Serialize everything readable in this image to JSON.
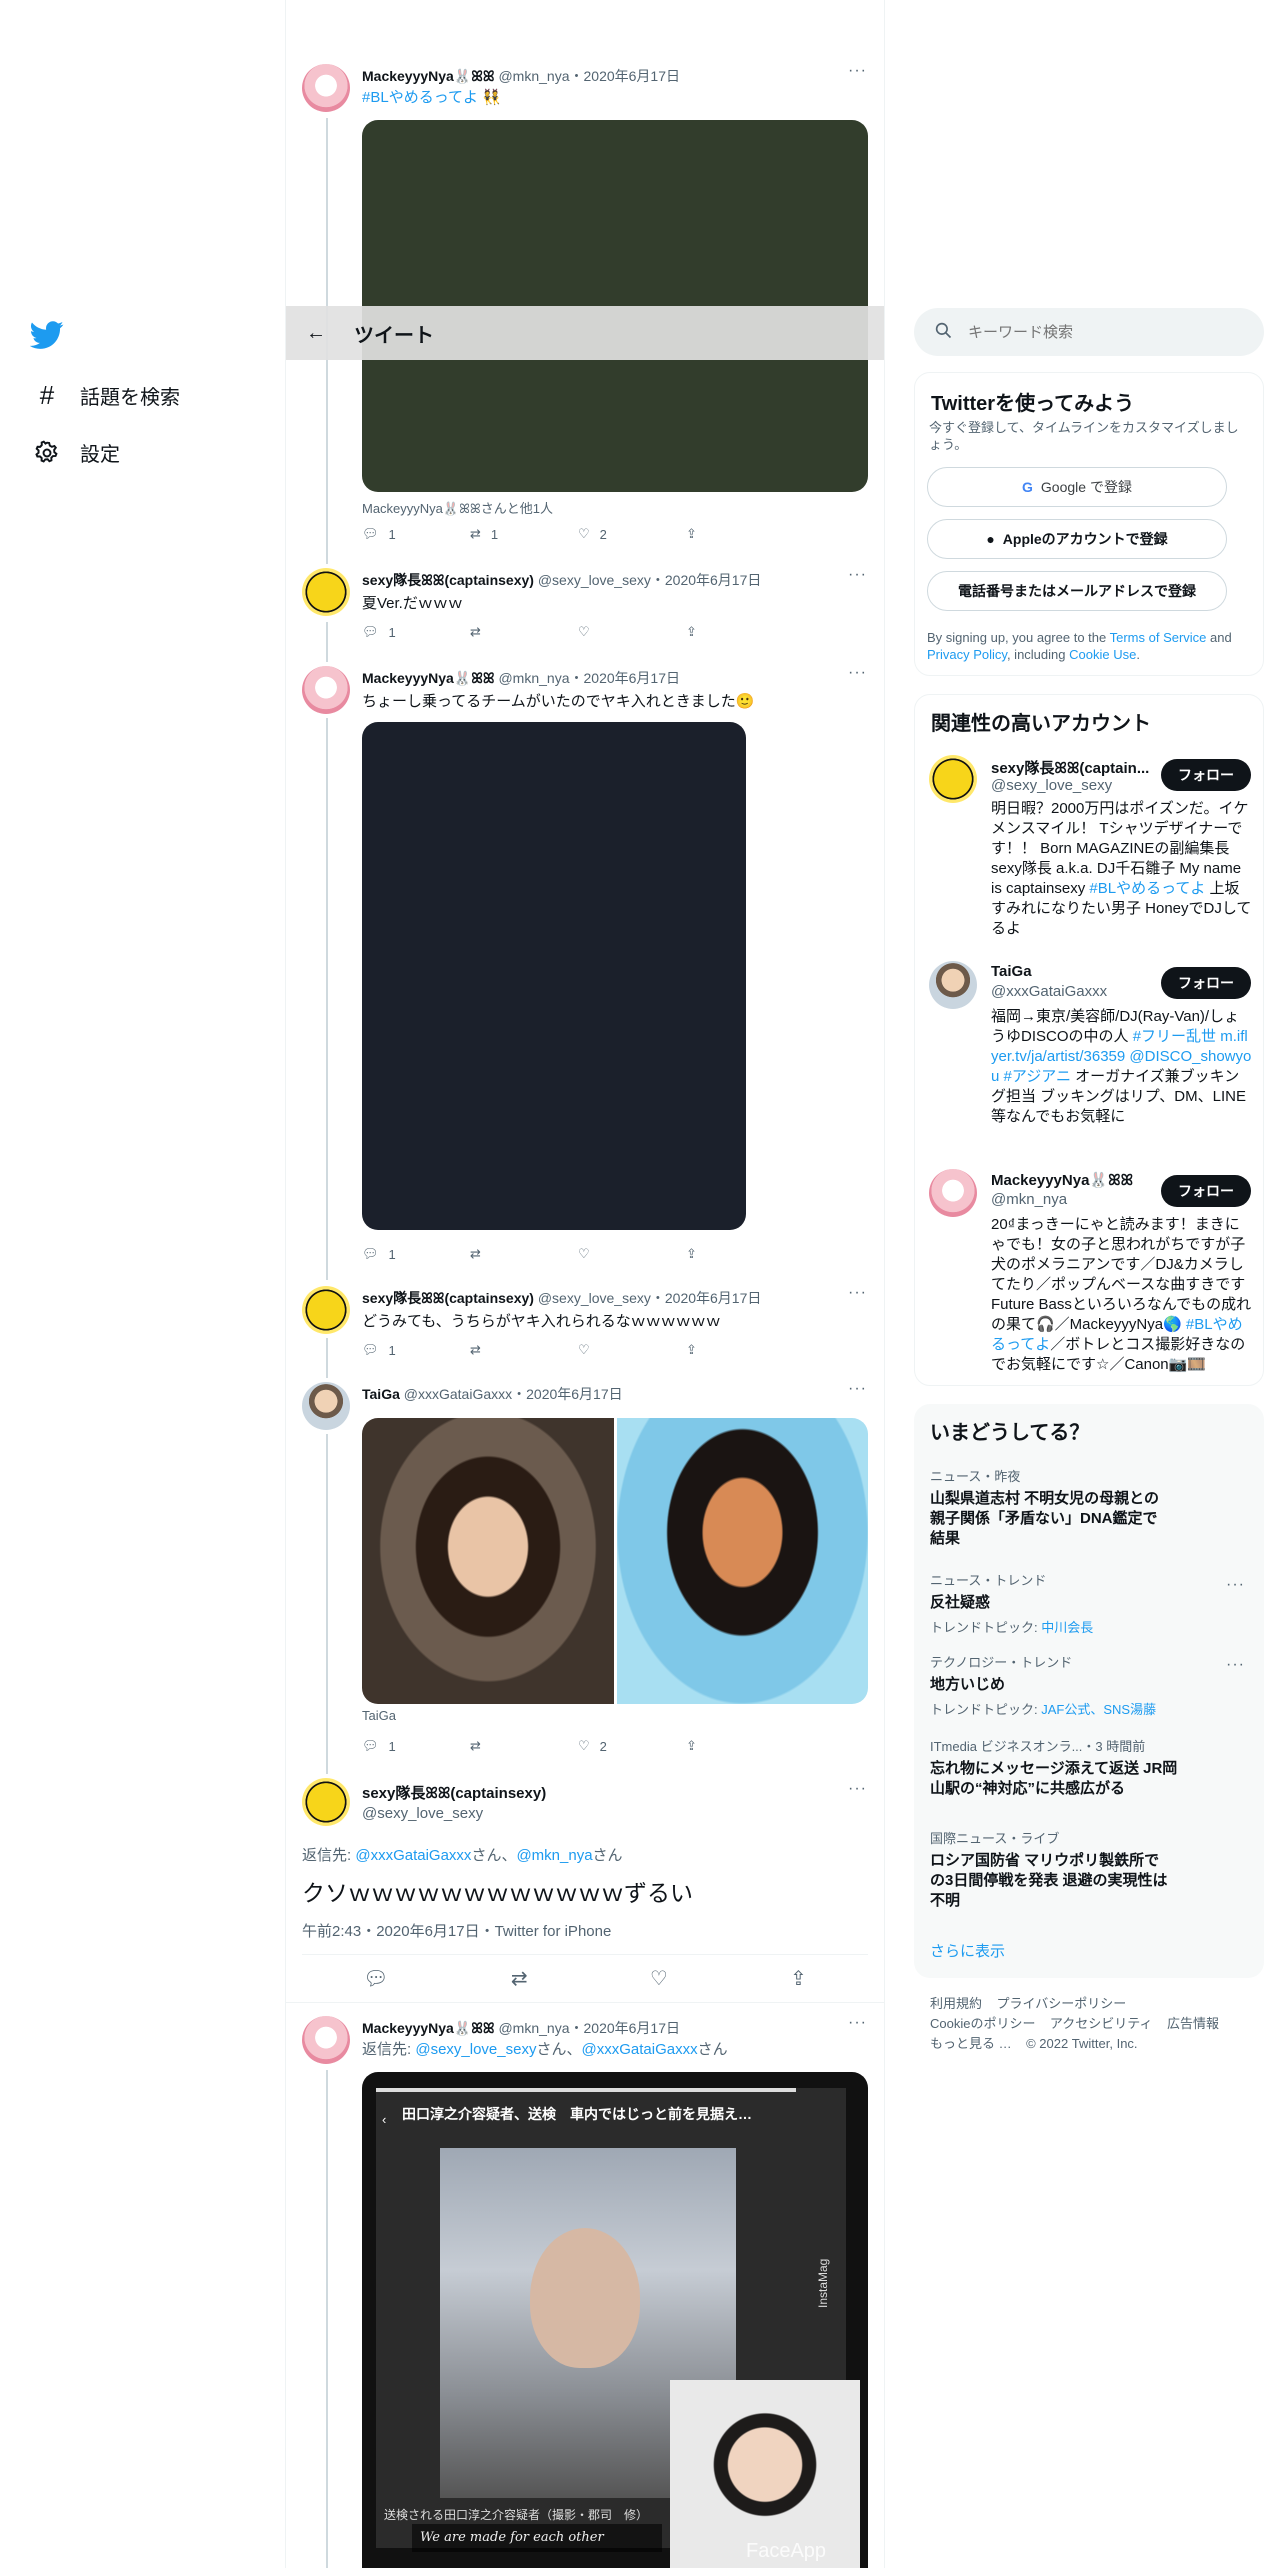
{
  "nav": {
    "explore_label": "話題を検索",
    "settings_label": "設定"
  },
  "header": {
    "title": "ツイート"
  },
  "search": {
    "placeholder": "キーワード検索"
  },
  "tweets": [
    {
      "name": "MackeyyyNya🐰ꕤꕤ",
      "handle": "@mkn_nya",
      "date": "・2020年6月17日",
      "text_link": "#BLやめるってよ",
      "text_rest": " 👯",
      "caption": "MackeyyyNya🐰ꕤꕤさんと他1人",
      "replies": "1",
      "retweets": "1",
      "likes": "2"
    },
    {
      "name": "sexy隊長ꕤꕤ(captainsexy)",
      "handle": "@sexy_love_sexy",
      "date": "・2020年6月17日",
      "text": "夏Ver.だｗｗｗ",
      "replies": "1",
      "retweets": "",
      "likes": ""
    },
    {
      "name": "MackeyyyNya🐰ꕤꕤ",
      "handle": "@mkn_nya",
      "date": "・2020年6月17日",
      "text": "ちょーし乗ってるチームがいたのでヤキ入れときました🙂",
      "replies": "1",
      "retweets": "",
      "likes": ""
    },
    {
      "name": "sexy隊長ꕤꕤ(captainsexy)",
      "handle": "@sexy_love_sexy",
      "date": "・2020年6月17日",
      "text": "どうみても、うちらがヤキ入れられるなｗｗｗｗｗｗ",
      "replies": "1",
      "retweets": "",
      "likes": ""
    },
    {
      "name": "TaiGa",
      "handle": "@xxxGataiGaxxx",
      "date": "・2020年6月17日",
      "caption": "TaiGa",
      "replies": "1",
      "retweets": "",
      "likes": "2"
    }
  ],
  "focus": {
    "name": "sexy隊長ꕤꕤ(captainsexy)",
    "handle": "@sexy_love_sexy",
    "reply_prefix": "返信先: ",
    "reply_to_1": "@xxxGataiGaxxx",
    "reply_mid": "さん、",
    "reply_to_2": "@mkn_nya",
    "reply_suffix": "さん",
    "text": "クソｗｗｗｗｗｗｗｗｗｗｗｗずるい",
    "meta": "午前2:43・2020年6月17日・Twitter for iPhone"
  },
  "last_tweet": {
    "name": "MackeyyyNya🐰ꕤꕤ",
    "handle": "@mkn_nya",
    "date": "・2020年6月17日",
    "reply_prefix": "返信先: ",
    "reply_to_1": "@sexy_love_sexy",
    "reply_mid": "さん、",
    "reply_to_2": "@xxxGataiGaxxx",
    "reply_suffix": "さん",
    "media_headline": "田口淳之介容疑者、送検　車内ではじっと前を見据え…",
    "media_caption": "送検される田口淳之介容疑者（撮影・郡司　修）",
    "media_side": "InstaMag",
    "media_bottom": "We are made for each other",
    "media_brand": "FaceApp"
  },
  "signup": {
    "title": "Twitterを使ってみよう",
    "subtitle": "今すぐ登録して、タイムラインをカスタマイズしましょう。",
    "google": "Google で登録",
    "apple": "Appleのアカウントで登録",
    "phone": "電話番号またはメールアドレスで登録",
    "terms_1": "By signing up, you agree to the ",
    "terms_link1": "Terms of Service",
    "terms_2": " and ",
    "terms_link2": "Privacy Policy",
    "terms_3": ", including ",
    "terms_link3": "Cookie Use",
    "terms_4": "."
  },
  "related": {
    "title": "関連性の高いアカウント",
    "follow_label": "フォロー",
    "accounts": [
      {
        "name": "sexy隊長ꕤꕤ(captain...",
        "handle": "@sexy_love_sexy",
        "bio": "明日暇？2000万円はポイズンだ。イケメンスマイル！ Tシャツデザイナーです！！ Born MAGAZINEの副編集長 sexy隊長 a.k.a. DJ千石雛子 My name is captainsexy ",
        "bio_link": "#BLやめるってよ",
        "bio_rest": " 上坂すみれになりたい男子 HoneyでDJしてるよ"
      },
      {
        "name": "TaiGa",
        "handle": "@xxxGataiGaxxx",
        "bio_1": "福岡→東京/美容師/DJ(Ray-Van)/しょうゆDISCOの中の人 ",
        "bio_link1": "#フリー乱世",
        "bio_2": " ",
        "bio_link2": "m.iflyer.tv/ja/artist/36359",
        "bio_3": " ",
        "bio_link3": "@DISCO_showyou",
        "bio_4": " ",
        "bio_link4": "#アジアニ",
        "bio_5": " オーガナイズ兼ブッキング担当 ブッキングはリプ、DM、LINE等なんでもお気軽に"
      },
      {
        "name": "MackeyyyNya🐰ꕤꕤ",
        "handle": "@mkn_nya",
        "bio": "20₫まっきーにゃと読みます！まきにゃでも！女の子と思われがちですが子犬のポメラニアンです／DJ&カメラしてたり／ポップんベースな曲すきですFuture Bassといろいろなんでもの成れの果て🎧／MackeyyyNya🌎 ",
        "bio_link": "#BLやめるってよ",
        "bio_rest": "／ボトレとコス撮影好きなのでお気軽にです☆／Canon📷🎞️"
      }
    ]
  },
  "trends": {
    "title": "いまどうしてる？",
    "items": [
      {
        "meta": "ニュース・昨夜",
        "title": "山梨県道志村 不明女児の母親との親子関係「矛盾ない」DNA鑑定で結果",
        "sub": "",
        "sub_link": ""
      },
      {
        "meta": "ニュース・トレンド",
        "title": "反社疑惑",
        "sub": "トレンドトピック: ",
        "sub_link": "中川会長"
      },
      {
        "meta": "テクノロジー・トレンド",
        "title": "地方いじめ",
        "sub": "トレンドトピック: ",
        "sub_link": "JAF公式、SNS湯藤"
      },
      {
        "meta": "ITmedia ビジネスオンラ...・3 時間前",
        "title": "忘れ物にメッセージ添えて返送 JR岡山駅の“神対応”に共感広がる",
        "sub": "",
        "sub_link": ""
      },
      {
        "meta": "国際ニュース・ライブ",
        "title": "ロシア国防省 マリウポリ製鉄所での3日間停戦を発表 退避の実現性は不明",
        "sub": "",
        "sub_link": ""
      }
    ],
    "show_more": "さらに表示"
  },
  "footer": {
    "links_row1": [
      "利用規約",
      "プライバシーポリシー"
    ],
    "links_row2": [
      "Cookieのポリシー",
      "アクセシビリティ",
      "広告情報"
    ],
    "more": "もっと見る …",
    "copyright": "© 2022 Twitter, Inc."
  },
  "colors": {
    "accent": "#1d9bf0",
    "text": "#0f1419",
    "muted": "#536471"
  }
}
